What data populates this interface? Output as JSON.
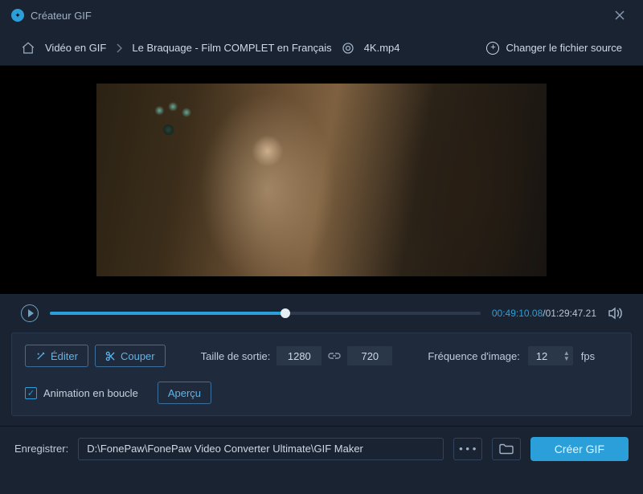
{
  "titlebar": {
    "title": "Créateur GIF"
  },
  "breadcrumb": {
    "item1": "Vidéo en GIF",
    "item2": "Le Braquage - Film COMPLET en Français",
    "ext": "4K.mp4",
    "change_source": "Changer le fichier source"
  },
  "player": {
    "current": "00:49:10.08",
    "total": "01:29:47.21",
    "progress_pct": 54.7
  },
  "controls": {
    "edit": "Éditer",
    "cut": "Couper",
    "output_size_label": "Taille de sortie:",
    "width": "1280",
    "height": "720",
    "fps_label": "Fréquence d'image:",
    "fps_value": "12",
    "fps_unit": "fps",
    "loop_label": "Animation en boucle",
    "preview": "Aperçu"
  },
  "output": {
    "save_label": "Enregistrer:",
    "path": "D:\\FonePaw\\FonePaw Video Converter Ultimate\\GIF Maker",
    "create": "Créer GIF"
  }
}
